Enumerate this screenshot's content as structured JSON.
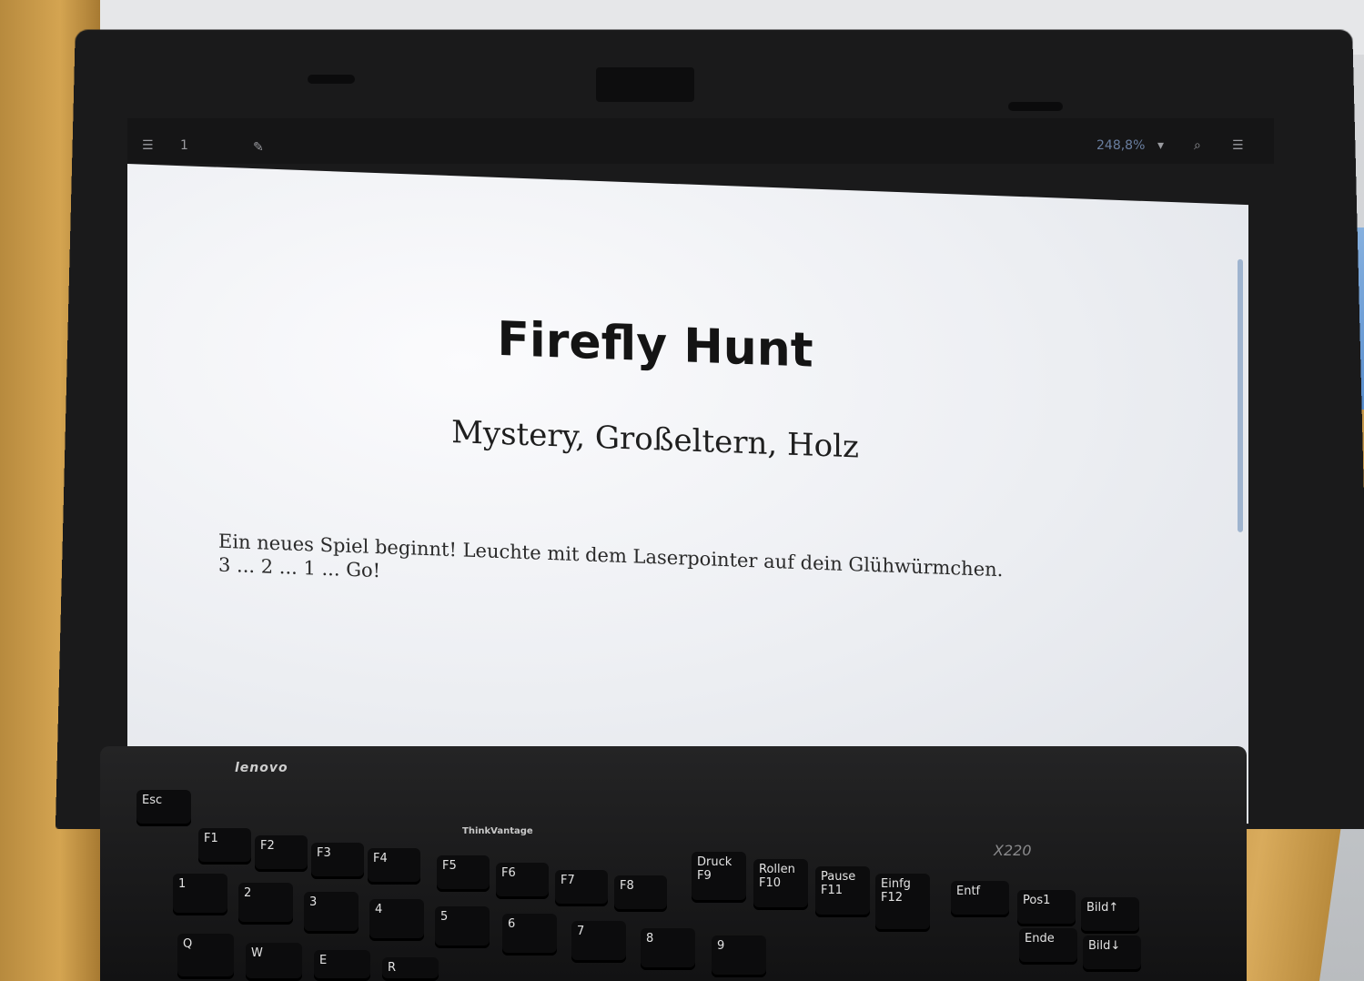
{
  "viewer": {
    "page_number": "1",
    "zoom": "248,8%"
  },
  "document": {
    "title": "Firefly Hunt",
    "subtitle": "Mystery, Großeltern, Holz",
    "body_line1": "Ein neues Spiel beginnt! Leuchte mit dem Laserpointer auf dein Glühwürmchen.",
    "body_line2": "3 ... 2 ... 1 ... Go!"
  },
  "laptop": {
    "brand": "lenovo",
    "model": "X220",
    "thinkvantage": "ThinkVantage"
  },
  "keys": {
    "esc": "Esc",
    "f1": "F1",
    "f2": "F2",
    "f3": "F3",
    "f4": "F4",
    "f5": "F5",
    "f6": "F6",
    "f7": "F7",
    "f8": "F8",
    "f9": "F9",
    "f10": "F10",
    "f11": "F11",
    "f12": "F12",
    "druck": "Druck",
    "rollen": "Rollen",
    "pause": "Pause",
    "einfg": "Einfg",
    "entf": "Entf",
    "pos1": "Pos1",
    "ende": "Ende",
    "bild_up": "Bild↑",
    "bild_down": "Bild↓",
    "q": "Q",
    "w": "W",
    "e": "E",
    "r": "R",
    "n1": "1",
    "n2": "2",
    "n3": "3",
    "n4": "4",
    "n5": "5",
    "n6": "6",
    "n7": "7",
    "n8": "8",
    "n9": "9"
  }
}
